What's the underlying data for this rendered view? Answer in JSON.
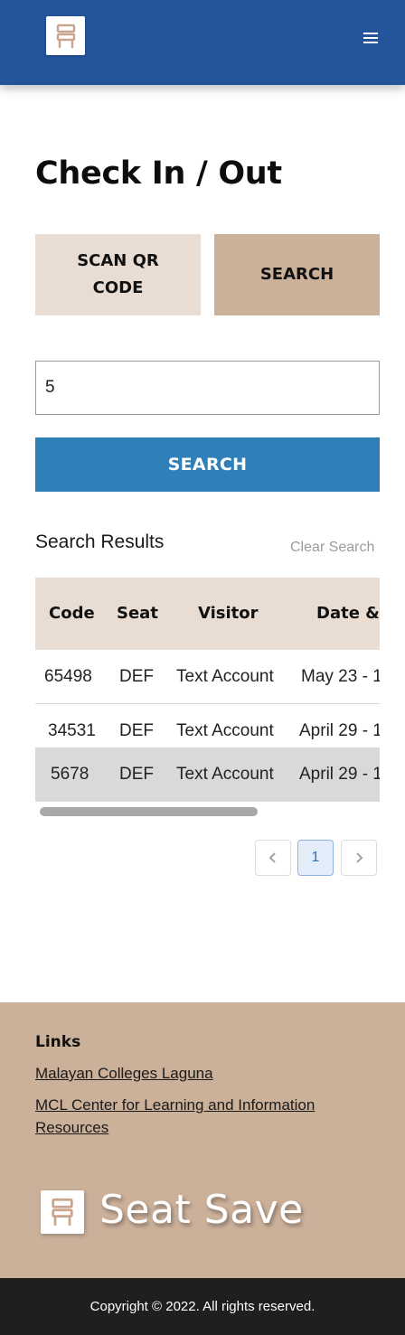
{
  "header": {
    "logo_icon": "seat-chair-icon",
    "menu_icon": "hamburger-menu-icon"
  },
  "main": {
    "title": "Check In / Out",
    "mode_tabs": [
      {
        "label": "SCAN QR CODE",
        "active": false
      },
      {
        "label": "SEARCH",
        "active": true
      }
    ],
    "search": {
      "value": "5",
      "button_label": "SEARCH"
    },
    "results": {
      "title": "Search Results",
      "clear_label": "Clear Search",
      "columns": [
        "Code",
        "Seat",
        "Visitor",
        "Date &"
      ],
      "rows": [
        {
          "code": "65498",
          "seat": "DEF",
          "visitor": "Text Account",
          "date": "May 23 - 1"
        },
        {
          "code": "34531",
          "seat": "DEF",
          "visitor": "Text Account",
          "date": "April 29 - 1"
        },
        {
          "code": "5678",
          "seat": "DEF",
          "visitor": "Text Account",
          "date": "April 29 - 1"
        }
      ]
    },
    "pagination": {
      "prev_icon": "chevron-left-icon",
      "current_page": "1",
      "next_icon": "chevron-right-icon"
    }
  },
  "footer": {
    "links_heading": "Links",
    "links": [
      "Malayan Colleges Laguna",
      "MCL Center for Learning and Information Resources"
    ],
    "brand_name": "Seat Save",
    "copyright": "Copyright © 2022. All rights reserved."
  },
  "colors": {
    "header_bg": "#24549a",
    "tab_inactive": "#e8dcd3",
    "tab_active": "#cbb19a",
    "search_button": "#2f7fb8",
    "table_header": "#e8dcd3",
    "highlight_row": "#d8d9da",
    "footer_bg": "#cbb09a",
    "copyright_bg": "#1f1f1f"
  }
}
